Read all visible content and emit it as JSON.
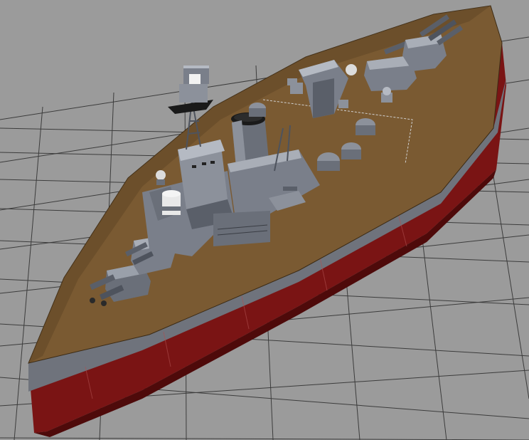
{
  "viewport": {
    "kind": "3d-modeling-perspective-viewport",
    "grid_visible": true,
    "model": "battleship-model",
    "shading": "textured"
  },
  "colors": {
    "background": "#9b9b9b",
    "grid_line": "#3c3c3c",
    "deck": "#7a5a32",
    "deck_dark": "#5e4424",
    "hull_red": "#7a1414",
    "hull_red_dark": "#4e0a0a",
    "hull_grey": "#6f737c",
    "superstructure": "#7a7f8a",
    "superstructure_dark": "#4e535d",
    "superstructure_light": "#a9aeb7",
    "funnel_top": "#1a1a1a",
    "white_detail": "#e8e8e8"
  }
}
